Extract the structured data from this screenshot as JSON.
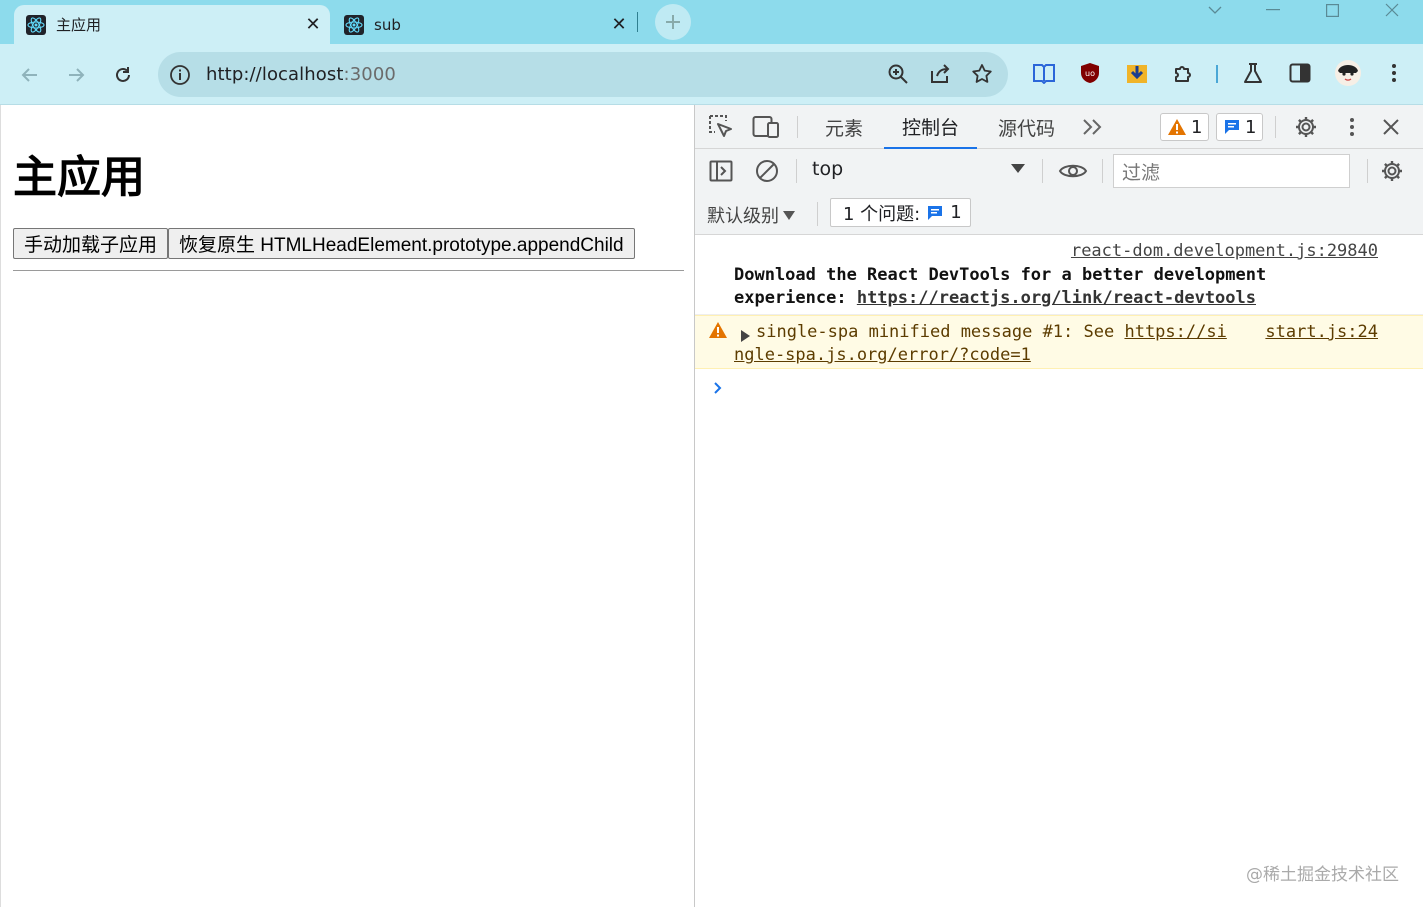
{
  "browser": {
    "tabs": [
      {
        "title": "主应用",
        "active": true
      },
      {
        "title": "sub",
        "active": false
      }
    ],
    "url_host": "http://localhost",
    "url_port": ":3000"
  },
  "page": {
    "heading": "主应用",
    "buttons": [
      "手动加载子应用",
      "恢复原生 HTMLHeadElement.prototype.appendChild"
    ]
  },
  "devtools": {
    "tabs": [
      "元素",
      "控制台",
      "源代码"
    ],
    "active_tab": "控制台",
    "warning_count": "1",
    "message_count": "1",
    "context": "top",
    "filter_placeholder": "过滤",
    "levels_label": "默认级别",
    "issues_label": "1 个问题:",
    "issues_count": "1",
    "messages": [
      {
        "level": "info",
        "source": "react-dom.development.js:29840",
        "line1": "Download the React DevTools for a better development",
        "line2_prefix": "experience: ",
        "link": "https://reactjs.org/link/react-devtools"
      },
      {
        "level": "warning",
        "source": "start.js:24",
        "text": "single-spa minified message #1: See ",
        "link_part1": "https://si",
        "link_part2": "ngle-spa.js.org/error/?code=1"
      }
    ]
  },
  "watermark": "@稀土掘金技术社区",
  "colors": {
    "tabstrip": "#8ddbec",
    "toolbar": "#cdeff6",
    "accent": "#1a73e8",
    "warning_bg": "#fffbe5"
  }
}
